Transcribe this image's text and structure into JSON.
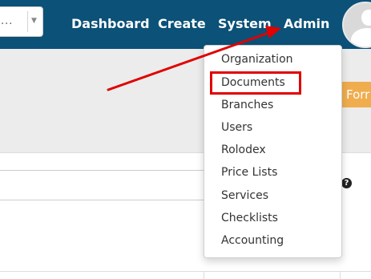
{
  "navbar": {
    "bg_color": "#0b5178",
    "select_value": "...",
    "links": {
      "dashboard": "Dashboard",
      "create": "Create",
      "system": "System",
      "admin": "Admin"
    }
  },
  "toolbar": {
    "form_button_label": "Forr",
    "form_button_color": "#f0ad4e"
  },
  "search": {
    "help_icon": "?"
  },
  "admin_menu": {
    "items": [
      "Organization",
      "Documents",
      "Branches",
      "Users",
      "Rolodex",
      "Price Lists",
      "Services",
      "Checklists",
      "Accounting"
    ],
    "highlighted_item": "Documents",
    "annotation_color": "#e00000"
  }
}
